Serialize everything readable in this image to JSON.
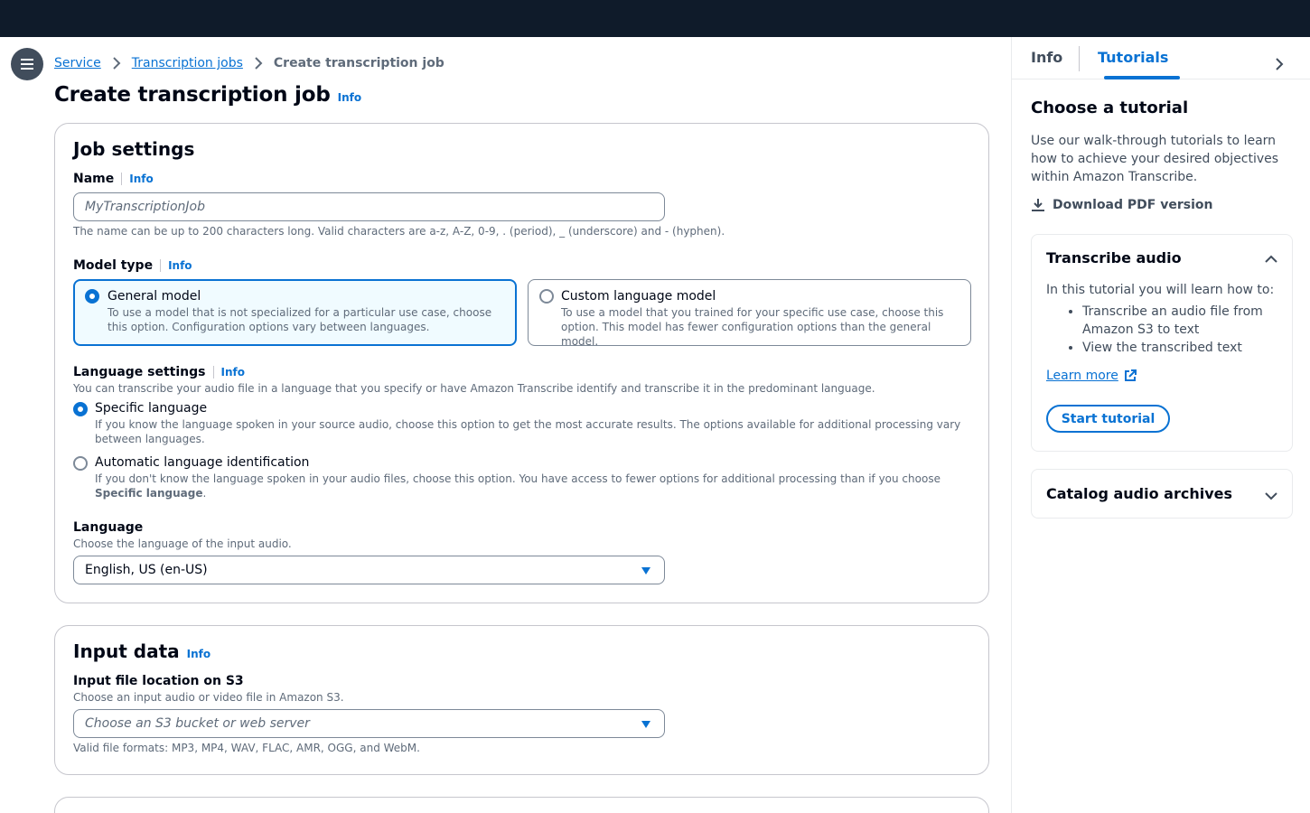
{
  "breadcrumb": {
    "items": [
      "Service",
      "Transcription jobs"
    ],
    "current": "Create transcription job"
  },
  "page": {
    "title": "Create transcription job",
    "info": "Info"
  },
  "job_settings": {
    "title": "Job settings",
    "name_label": "Name",
    "name_info": "Info",
    "name_placeholder": "MyTranscriptionJob",
    "name_hint": "The name can be up to 200 characters long. Valid characters are a-z, A-Z, 0-9, . (period), _ (underscore) and - (hyphen).",
    "model_label": "Model type",
    "model_info": "Info",
    "models": [
      {
        "title": "General model",
        "desc": "To use a model that is not specialized for a particular use case, choose this option. Configuration options vary between languages.",
        "selected": true
      },
      {
        "title": "Custom language model",
        "desc": "To use a model that you trained for your specific use case, choose this option. This model has fewer configuration options than the general model.",
        "selected": false
      }
    ],
    "lang_settings_label": "Language settings",
    "lang_settings_info": "Info",
    "lang_settings_desc": "You can transcribe your audio file in a language that you specify or have Amazon Transcribe identify and transcribe it in the predominant language.",
    "lang_options": [
      {
        "title": "Specific language",
        "desc": "If you know the language spoken in your source audio, choose this option to get the most accurate results. The options available for additional processing vary between languages.",
        "selected": true
      },
      {
        "title": "Automatic language identification",
        "desc": "If you don't know the language spoken in your audio files, choose this option. You have access to fewer options for additional processing than if you choose ",
        "desc_bold": "Specific language",
        "desc_end": ".",
        "selected": false
      }
    ],
    "language_label": "Language",
    "language_desc": "Choose the language of the input audio.",
    "language_value": "English, US (en-US)"
  },
  "input_data": {
    "title": "Input data",
    "info": "Info",
    "location_label": "Input file location on S3",
    "location_desc": "Choose an input audio or video file in Amazon S3.",
    "location_placeholder": "Choose an S3 bucket or web server",
    "formats_hint": "Valid file formats: MP3, MP4, WAV, FLAC, AMR, OGG, and WebM."
  },
  "side_panel": {
    "tabs": [
      "Info",
      "Tutorials"
    ],
    "active_tab": "Tutorials",
    "heading": "Choose a tutorial",
    "intro": "Use our walk-through tutorials to learn how to achieve your desired objectives within Amazon Transcribe.",
    "download": "Download PDF version",
    "tutorial": {
      "title": "Transcribe audio",
      "intro": "In this tutorial you will learn how to:",
      "steps": [
        "Transcribe an audio file from Amazon S3 to text",
        "View the transcribed text"
      ],
      "learn_more": "Learn more",
      "start": "Start tutorial"
    },
    "tutorial2": {
      "title": "Catalog audio archives"
    }
  },
  "colors": {
    "accent": "#0972d3",
    "topbar": "#0f1b2a",
    "selected_bg": "#f0fbff"
  }
}
